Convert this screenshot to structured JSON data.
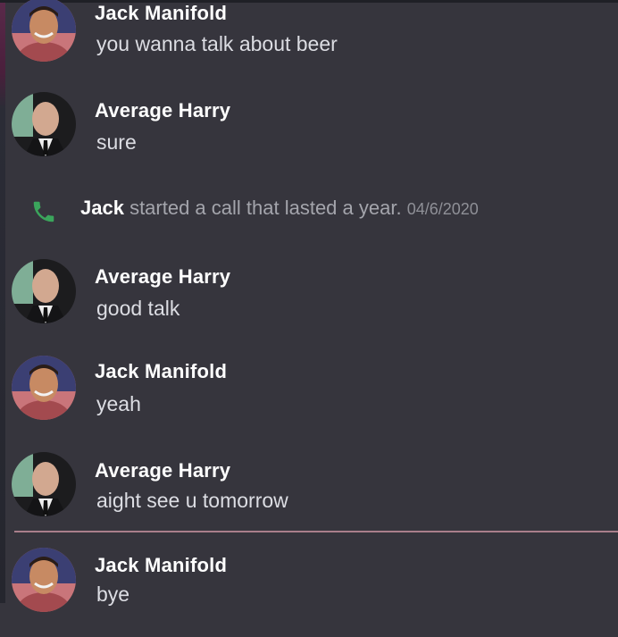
{
  "colors": {
    "background": "#36353d",
    "author_text": "#ffffff",
    "message_text": "#dcdde3",
    "system_text": "#a4a5ac",
    "date_text": "#8f9097",
    "call_icon": "#3ba55c",
    "new_messages_divider": "#a97f8b"
  },
  "messages": [
    {
      "author": "Jack Manifold",
      "text": "you wanna talk about  beer",
      "avatar_icon": "jack-avatar"
    },
    {
      "author": "Average Harry",
      "text": "sure",
      "avatar_icon": "harry-avatar"
    },
    {
      "author": "Average Harry",
      "text": "good talk",
      "avatar_icon": "harry-avatar"
    },
    {
      "author": "Jack Manifold",
      "text": "yeah",
      "avatar_icon": "jack-avatar"
    },
    {
      "author": "Average Harry",
      "text": "aight see u tomorrow",
      "avatar_icon": "harry-avatar"
    },
    {
      "author": "Jack Manifold",
      "text": "bye",
      "avatar_icon": "jack-avatar"
    }
  ],
  "system_message": {
    "icon": "phone-icon",
    "name": "Jack",
    "text": " started a call that lasted a year. ",
    "date": "04/6/2020"
  }
}
